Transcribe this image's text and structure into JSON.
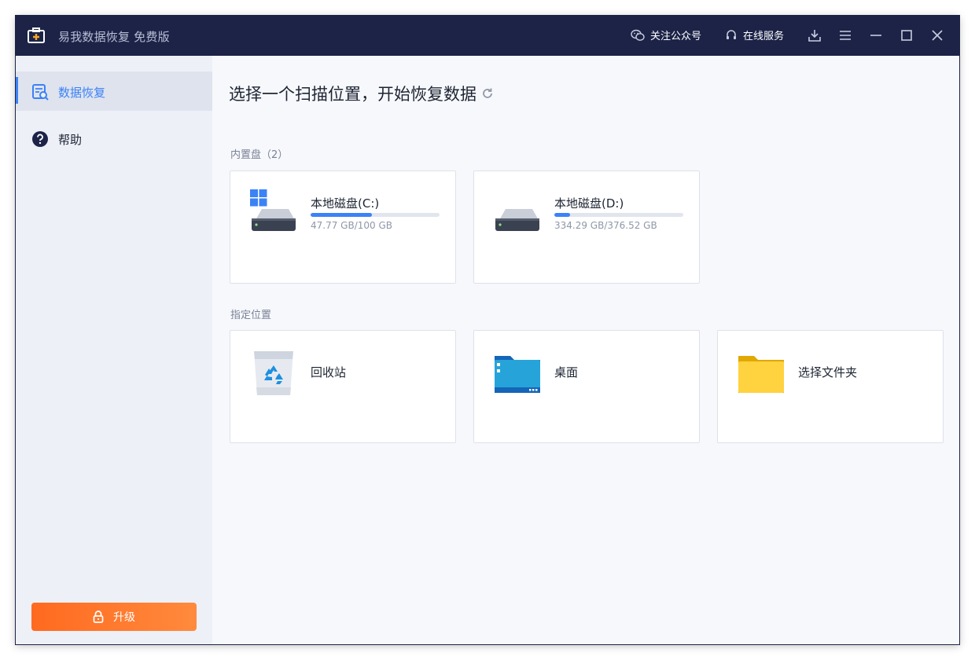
{
  "app": {
    "title": "易我数据恢复 免费版",
    "accent": "#3b82f6",
    "titlebar_color": "#1c2347",
    "upgrade_color": "#ff7a2f"
  },
  "titlebar": {
    "follow_label": "关注公众号",
    "service_label": "在线服务",
    "follow_icon": "wechat-icon",
    "service_icon": "headset-icon",
    "buttons": [
      "download-icon",
      "menu-icon",
      "minimize-icon",
      "maximize-icon",
      "close-icon"
    ]
  },
  "sidebar": {
    "items": [
      {
        "label": "数据恢复",
        "icon": "data-recovery-icon",
        "active": true
      },
      {
        "label": "帮助",
        "icon": "help-icon",
        "active": false
      }
    ],
    "upgrade_label": "升级",
    "upgrade_icon": "lock-icon"
  },
  "main": {
    "title": "选择一个扫描位置，开始恢复数据",
    "refresh_icon": "refresh-icon",
    "disks_section": "内置盘（2）",
    "disks": [
      {
        "name": "本地磁盘(C:)",
        "usage": "47.77 GB/100 GB",
        "used_fraction": 0.4777,
        "icon": "windows-drive-icon"
      },
      {
        "name": "本地磁盘(D:)",
        "usage": "334.29 GB/376.52 GB",
        "used_fraction": 0.12,
        "icon": "drive-icon"
      }
    ],
    "locations_section": "指定位置",
    "locations": [
      {
        "name": "回收站",
        "icon": "recycle-bin-icon"
      },
      {
        "name": "桌面",
        "icon": "desktop-folder-icon"
      },
      {
        "name": "选择文件夹",
        "icon": "folder-icon"
      }
    ]
  }
}
